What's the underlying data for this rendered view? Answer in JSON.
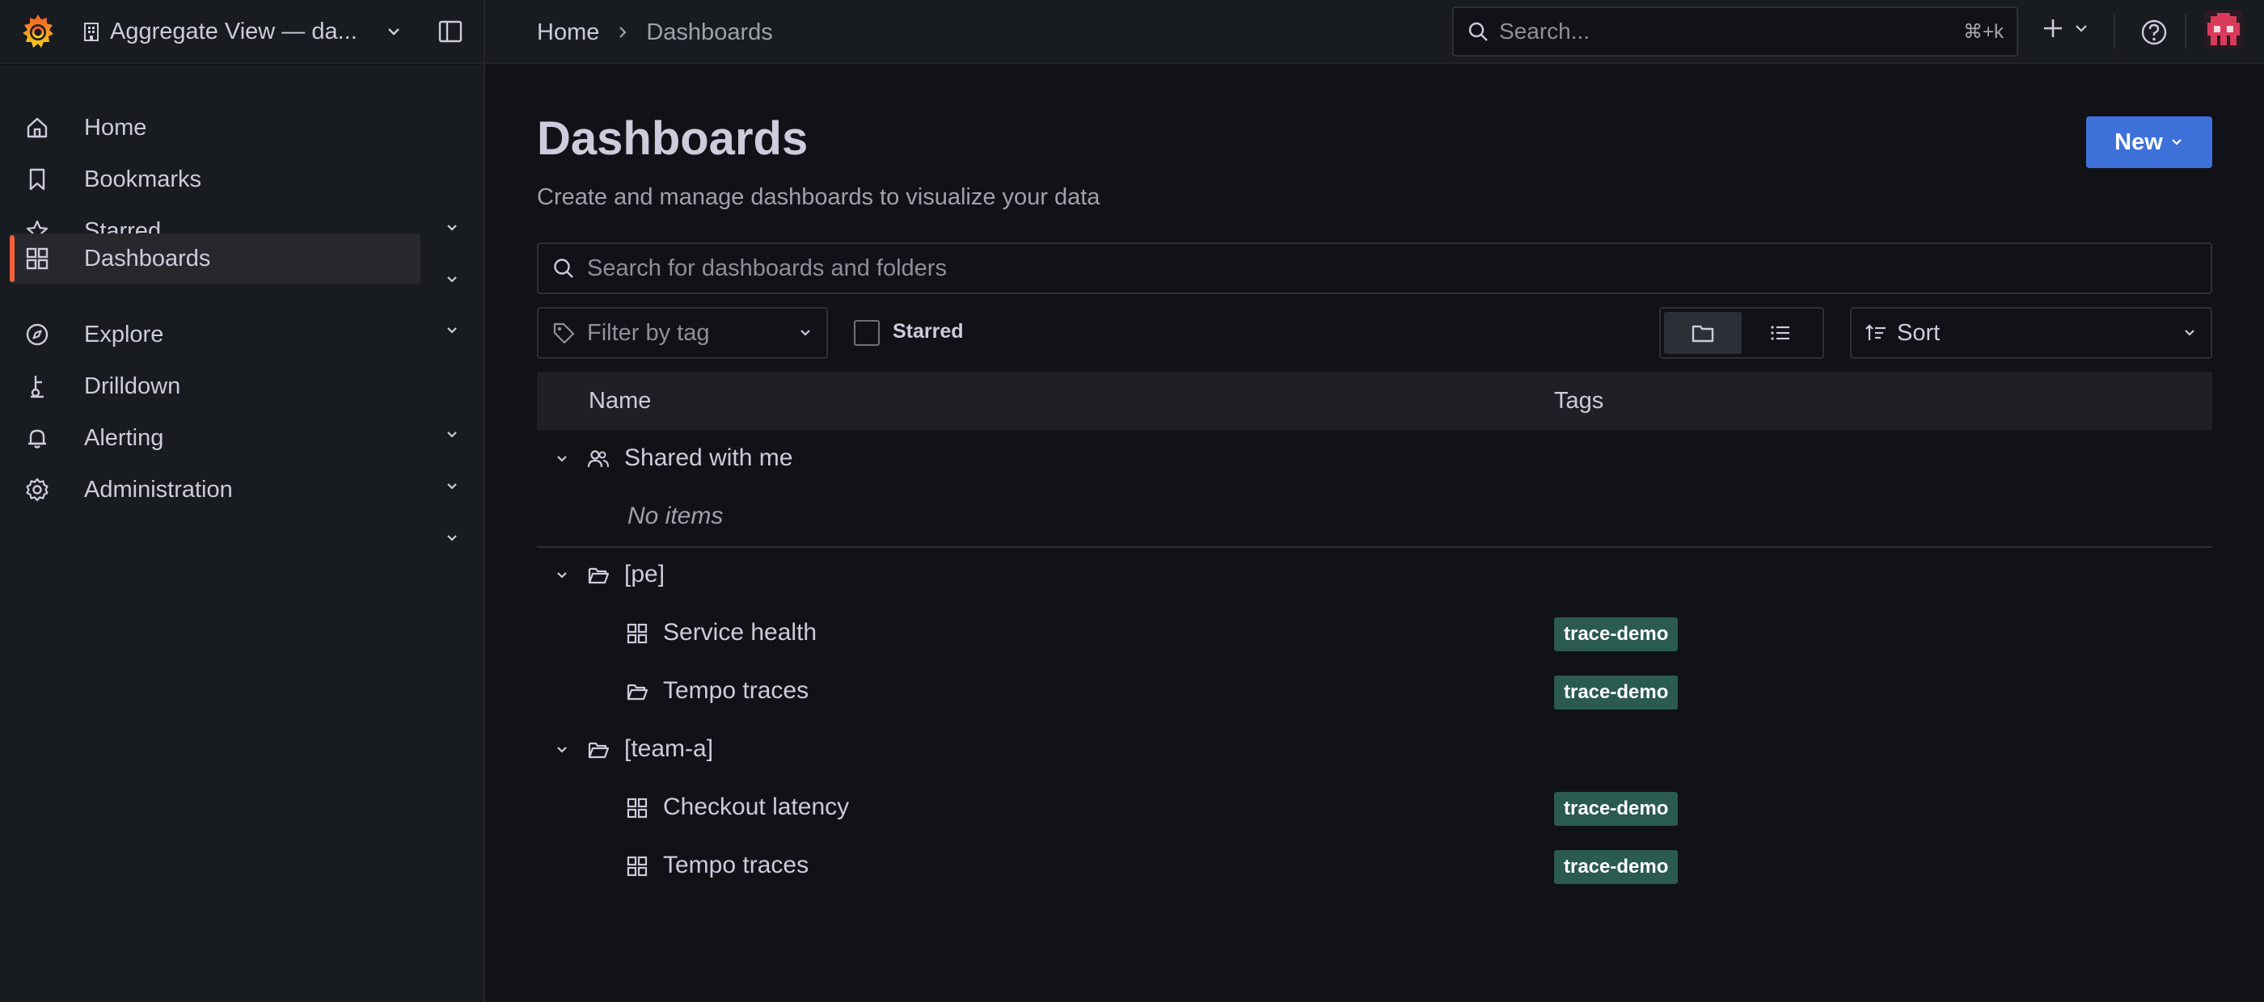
{
  "topbar": {
    "org_name": "Aggregate View — da...",
    "breadcrumb": {
      "home": "Home",
      "current": "Dashboards"
    },
    "search": {
      "placeholder": "Search...",
      "shortcut": "⌘+k"
    }
  },
  "sidebar": {
    "items": [
      {
        "label": "Home",
        "icon": "home-icon",
        "expandable": false,
        "active": false
      },
      {
        "label": "Bookmarks",
        "icon": "bookmark-icon",
        "expandable": true,
        "active": false
      },
      {
        "label": "Starred",
        "icon": "star-icon",
        "expandable": true,
        "active": false
      },
      {
        "label": "Dashboards",
        "icon": "apps-icon",
        "expandable": true,
        "active": true
      },
      {
        "label": "Explore",
        "icon": "compass-icon",
        "expandable": false,
        "active": false
      },
      {
        "label": "Drilldown",
        "icon": "drilldown-icon",
        "expandable": true,
        "active": false
      },
      {
        "label": "Alerting",
        "icon": "bell-icon",
        "expandable": true,
        "active": false
      },
      {
        "label": "Administration",
        "icon": "cog-icon",
        "expandable": true,
        "active": false
      }
    ]
  },
  "page": {
    "title": "Dashboards",
    "subtitle": "Create and manage dashboards to visualize your data",
    "new_button": "New"
  },
  "filters": {
    "search_placeholder": "Search for dashboards and folders",
    "tag_placeholder": "Filter by tag",
    "starred_label": "Starred",
    "starred_checked": false,
    "view_mode": "folders",
    "sort_placeholder": "Sort"
  },
  "table": {
    "columns": {
      "name": "Name",
      "tags": "Tags"
    },
    "rows": [
      {
        "kind": "folder",
        "label": "Shared with me",
        "icon": "users-icon"
      },
      {
        "kind": "empty",
        "label": "No items"
      },
      {
        "kind": "folder",
        "label": "[pe]",
        "icon": "folder-open-icon"
      },
      {
        "kind": "dashboard",
        "label": "Service health",
        "icon": "apps-icon",
        "tag": "trace-demo"
      },
      {
        "kind": "subfolder",
        "label": "Tempo traces",
        "icon": "folder-icon",
        "tag": "trace-demo"
      },
      {
        "kind": "folder",
        "label": "[team-a]",
        "icon": "folder-open-icon"
      },
      {
        "kind": "dashboard",
        "label": "Checkout latency",
        "icon": "apps-icon",
        "tag": "trace-demo"
      },
      {
        "kind": "dashboard",
        "label": "Tempo traces",
        "icon": "apps-icon",
        "tag": "trace-demo"
      }
    ]
  },
  "colors": {
    "accent": "#3d71d9",
    "active_indicator": "#f55f3e",
    "tag_bg": "#2a5a50",
    "background": "#111217",
    "panel": "#181b1f"
  }
}
